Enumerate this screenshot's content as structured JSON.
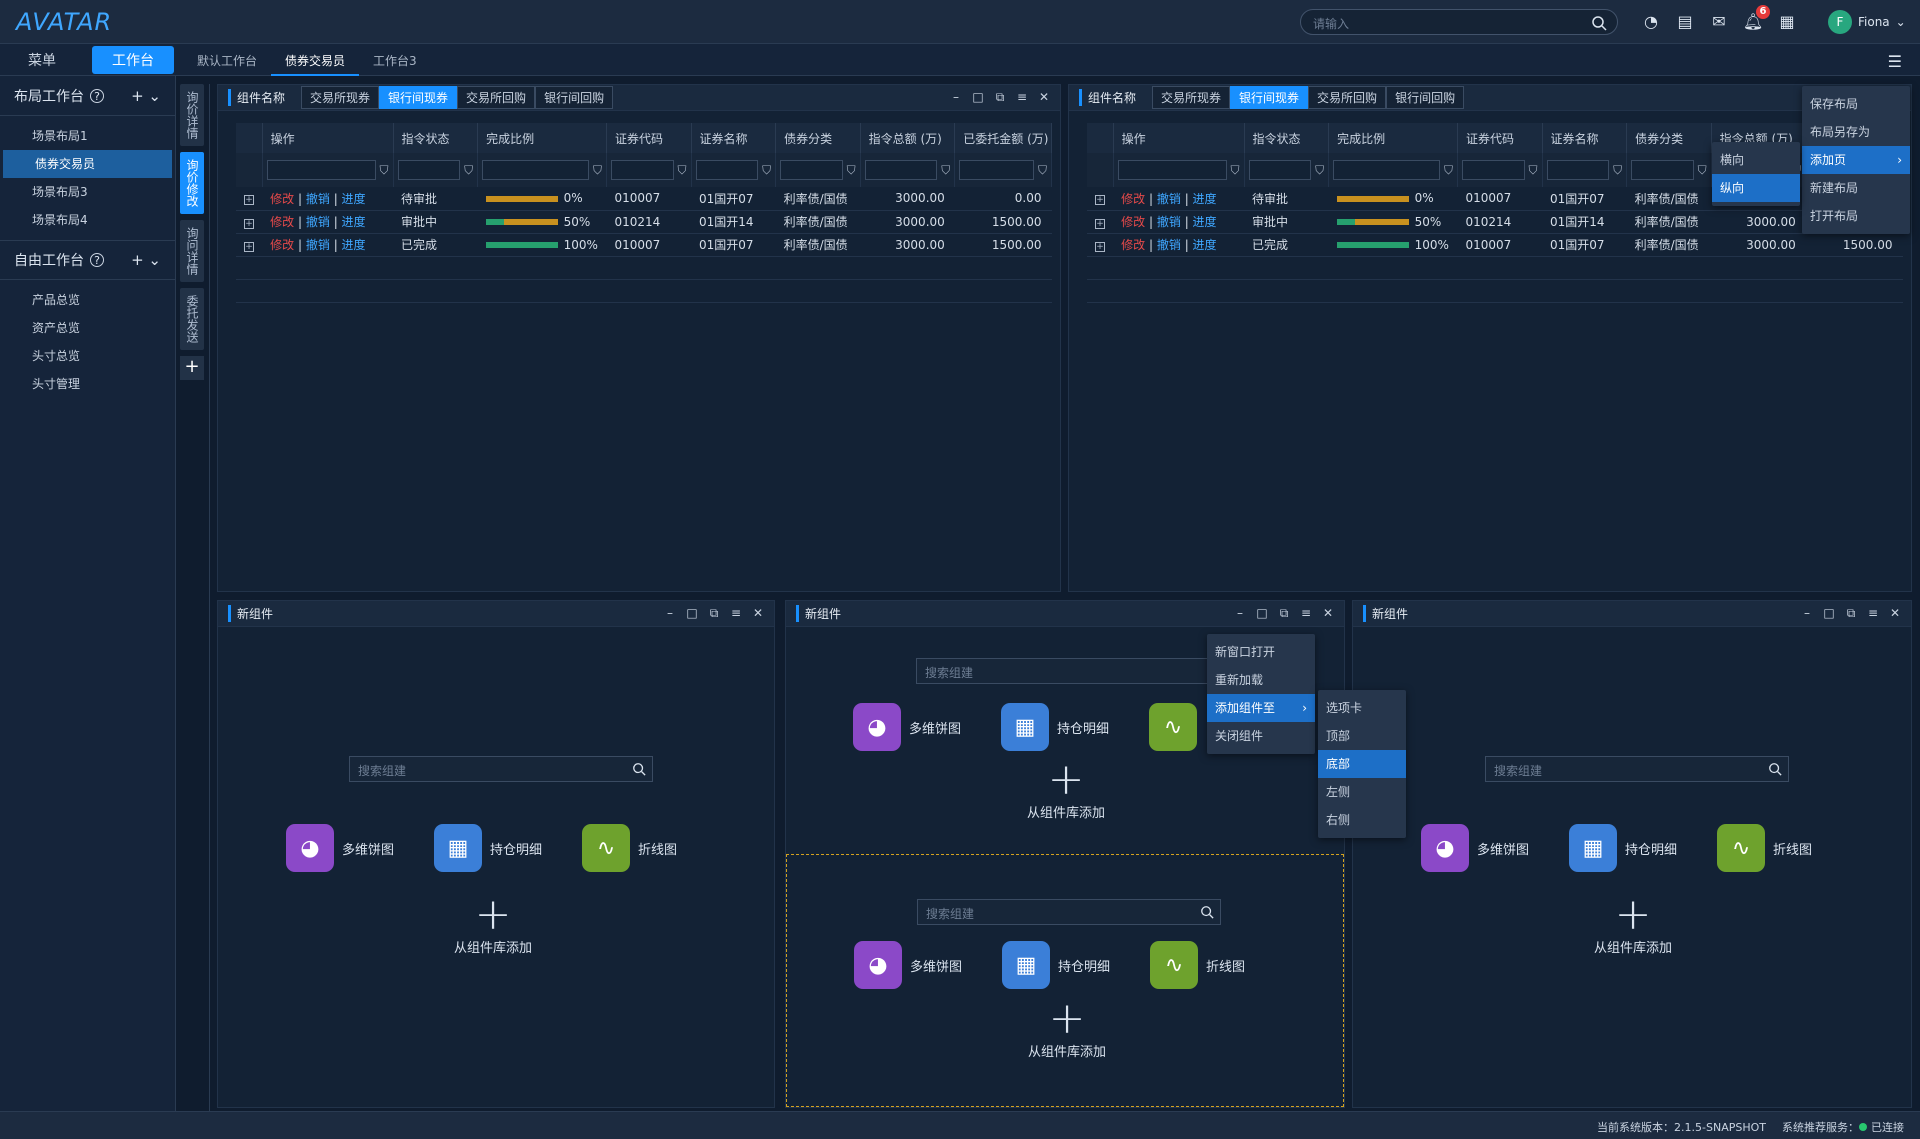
{
  "app": {
    "logo": "AVATAR",
    "search_placeholder": "请输入",
    "notif_count": "6",
    "user_initial": "F",
    "user_name": "Fiona"
  },
  "subnav": {
    "menu": "菜单",
    "workbench": "工作台",
    "tabs": [
      "默认工作台",
      "债券交易员",
      "工作台3"
    ],
    "active_tab": 1
  },
  "sidebar": {
    "layout_title": "布局工作台",
    "layout_items": [
      "场景布局1",
      "债券交易员",
      "场景布局3",
      "场景布局4"
    ],
    "layout_active": 1,
    "free_title": "自由工作台",
    "free_items": [
      "产品总览",
      "资产总览",
      "头寸总览",
      "头寸管理"
    ]
  },
  "vstrip": [
    "询价详情",
    "询价修改",
    "询问详情",
    "委托发送"
  ],
  "vstrip_active": 1,
  "panel_left": {
    "title": "组件名称",
    "segs": [
      "交易所现券",
      "银行间现券",
      "交易所回购",
      "银行间回购"
    ],
    "active_seg": 1
  },
  "panel_right": {
    "title": "组件名称",
    "segs": [
      "交易所现券",
      "银行间现券",
      "交易所回购",
      "银行间回购"
    ],
    "active_seg": 1
  },
  "table": {
    "headers": [
      "操作",
      "指令状态",
      "完成比例",
      "证券代码",
      "证券名称",
      "债券分类",
      "指令总额 (万)",
      "已委托金额 (万)"
    ],
    "actions": [
      "修改",
      "撤销",
      "进度"
    ],
    "rows": [
      {
        "status": "待审批",
        "pct": "0%",
        "progress": 0,
        "code": "010007",
        "name": "01国开07",
        "cat": "利率债/国债",
        "total": "3000.00",
        "done": "0.00"
      },
      {
        "status": "审批中",
        "pct": "50%",
        "progress": 0.5,
        "code": "010214",
        "name": "01国开14",
        "cat": "利率债/国债",
        "total": "3000.00",
        "done": "1500.00"
      },
      {
        "status": "已完成",
        "pct": "100%",
        "progress": 1,
        "code": "010007",
        "name": "01国开07",
        "cat": "利率债/国债",
        "total": "3000.00",
        "done": "1500.00"
      }
    ]
  },
  "new_panels": {
    "title": "新组件",
    "search_placeholder": "搜索组建",
    "items": [
      "多维饼图",
      "持仓明细",
      "折线图"
    ],
    "add_label": "从组件库添加"
  },
  "layout_menu": {
    "items": [
      "保存布局",
      "布局另存为",
      "添加页",
      "新建布局",
      "打开布局"
    ],
    "highlight": 2,
    "sub": [
      "横向",
      "纵向"
    ],
    "sub_highlight": 1
  },
  "panel_menu": {
    "items": [
      "新窗口打开",
      "重新加载",
      "添加组件至",
      "关闭组件"
    ],
    "highlight": 2,
    "sub": [
      "选项卡",
      "顶部",
      "底部",
      "左侧",
      "右侧"
    ],
    "sub_highlight": 2
  },
  "status": {
    "version_label": "当前系统版本：",
    "version": "2.1.5-SNAPSHOT",
    "push_label": "系统推荐服务：",
    "push_state": "已连接"
  },
  "colors": {
    "accent": "#1890ff",
    "danger": "#e64a4a",
    "bar_low": "#c8911f",
    "bar_high": "#26a06e"
  }
}
